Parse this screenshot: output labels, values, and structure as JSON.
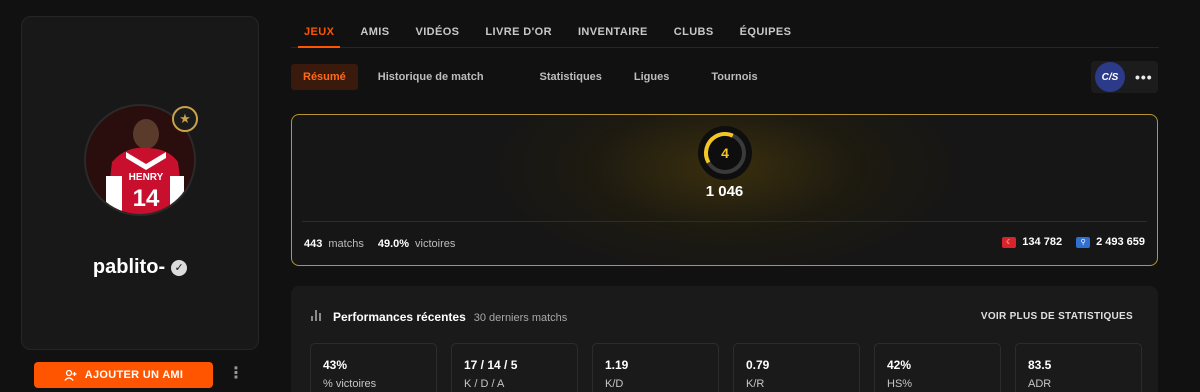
{
  "profile": {
    "username": "pablito-",
    "add_friend_label": "AJOUTER UN AMI",
    "rank_badge_icon": "star-icon",
    "verified_icon": "check-icon",
    "jersey_name": "HENRY",
    "jersey_number": "14"
  },
  "nav": {
    "tabs": [
      "JEUX",
      "AMIS",
      "VIDÉOS",
      "LIVRE D'OR",
      "INVENTAIRE",
      "CLUBS",
      "ÉQUIPES"
    ],
    "active_tab": "JEUX"
  },
  "subnav": {
    "tabs": [
      "Résumé",
      "Historique de match",
      "Statistiques",
      "Ligues",
      "Tournois"
    ],
    "active_tab": "Résumé",
    "game_logo": "CS",
    "more_label": "•••"
  },
  "elo": {
    "level": "4",
    "level_fraction": 0.4,
    "value": "1 046",
    "matches_value": "443",
    "matches_label": "matchs",
    "winrate_value": "49.0%",
    "winrate_label": "victoires",
    "country_rank": "134 782",
    "global_rank": "2 493 659"
  },
  "performance": {
    "title": "Performances récentes",
    "subtitle": "30 derniers matchs",
    "more_link": "VOIR PLUS DE STATISTIQUES",
    "stats": [
      {
        "value": "43%",
        "label": "% victoires"
      },
      {
        "value": "17 / 14 / 5",
        "label": "K / D / A"
      },
      {
        "value": "1.19",
        "label": "K/D"
      },
      {
        "value": "0.79",
        "label": "K/R"
      },
      {
        "value": "42%",
        "label": "HS%"
      },
      {
        "value": "83.5",
        "label": "ADR"
      }
    ]
  },
  "colors": {
    "accent": "#ff5500",
    "level_yellow": "#f3c623",
    "card_border_gold": "#b8952e"
  }
}
